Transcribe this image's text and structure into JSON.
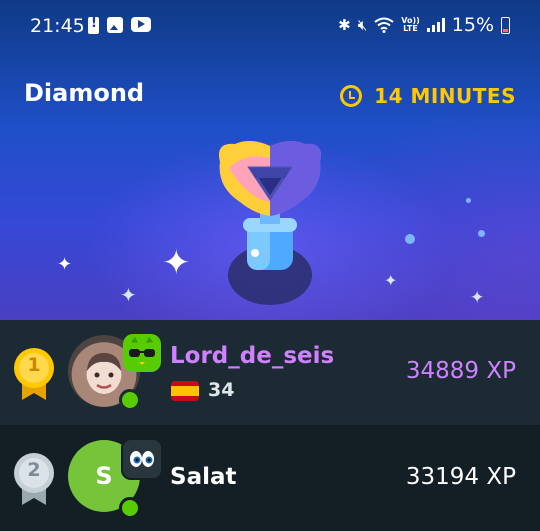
{
  "status_bar": {
    "time": "21:45",
    "left_icons": [
      "battery-alert-icon",
      "gallery-icon",
      "youtube-icon"
    ],
    "right_icons": [
      "bluetooth-icon",
      "mute-icon",
      "wifi-icon",
      "volte-icon",
      "signal-icon",
      "battery-icon"
    ],
    "volte_top": "Vo))",
    "volte_bottom": "LTE",
    "battery_percent": "15%"
  },
  "league": {
    "title": "Diamond",
    "time_left": "14 MINUTES",
    "timer_icon": "clock-icon",
    "trophy_icon": "diamond-trophy-icon"
  },
  "leaderboard": [
    {
      "rank": "1",
      "medal_color": "#ffc800",
      "username": "Lord_de_seis",
      "name_color": "#ce82ff",
      "flag": "spain-flag-icon",
      "streak": "34",
      "xp": "34889 XP",
      "avatar_type": "photo",
      "badge_icon": "sunglasses-badge-icon",
      "online": true,
      "is_current_user": true
    },
    {
      "rank": "2",
      "medal_color": "#c5d0d6",
      "username": "Salat",
      "name_color": "#ffffff",
      "avatar_letter": "S",
      "avatar_color": "#76c43a",
      "xp": "33194 XP",
      "badge_icon": "eyes-badge-icon",
      "online": true,
      "is_current_user": false
    }
  ],
  "colors": {
    "background": "#131f24",
    "current_row": "#1c2b33",
    "gold": "#ffc800",
    "purple": "#ce82ff",
    "green": "#58cc02"
  }
}
